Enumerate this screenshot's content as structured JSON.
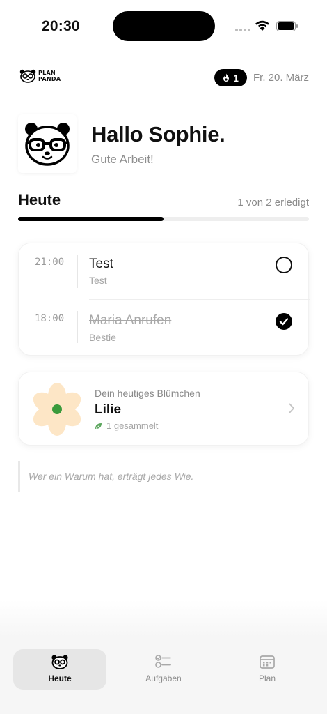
{
  "status_bar": {
    "time": "20:30"
  },
  "header": {
    "logo_line1": "PLAN",
    "logo_line2": "PANDA",
    "streak_count": "1",
    "date": "Fr. 20. März"
  },
  "greeting": {
    "title": "Hallo Sophie.",
    "subtitle": "Gute Arbeit!"
  },
  "today": {
    "title": "Heute",
    "progress_label": "1 von 2 erledigt",
    "progress_fraction": 0.5,
    "tasks": [
      {
        "time": "21:00",
        "title": "Test",
        "subtitle": "Test",
        "done": false
      },
      {
        "time": "18:00",
        "title": "Maria Anrufen",
        "subtitle": "Bestie",
        "done": true
      }
    ]
  },
  "flower": {
    "caption": "Dein heutiges Blümchen",
    "name": "Lilie",
    "count_label": "1 gesammelt",
    "petal_color": "#fde6c6",
    "center_color": "#3a9a3c"
  },
  "quote": {
    "text": "Wer ein Warum hat, erträgt jedes Wie."
  },
  "tabbar": {
    "tabs": [
      {
        "label": "Heute",
        "icon": "panda-icon",
        "active": true
      },
      {
        "label": "Aufgaben",
        "icon": "checklist-icon",
        "active": false
      },
      {
        "label": "Plan",
        "icon": "calendar-icon",
        "active": false
      }
    ]
  }
}
